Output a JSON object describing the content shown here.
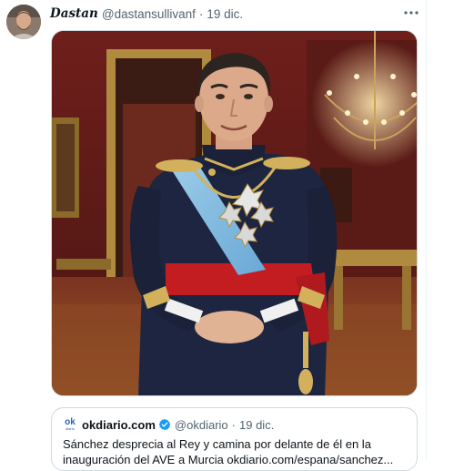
{
  "tweet": {
    "display_name": "Dastan",
    "handle": "@dastansullivanf",
    "separator": "·",
    "date": "19 dic.",
    "more_icon": "more-horizontal-icon"
  },
  "quote": {
    "logo_text": "ok",
    "logo_sub": "diario",
    "name": "okdiario.com",
    "handle": "@okdiario",
    "separator": "·",
    "date": "19 dic.",
    "text": "Sánchez desprecia al Rey y camina por delante de él en la inauguración del AVE a Murcia okdiario.com/espana/sanchez...",
    "verified_color": "#1d9bf0"
  },
  "colors": {
    "text": "#0f1419",
    "secondary": "#536471",
    "border": "#cfd9de"
  }
}
